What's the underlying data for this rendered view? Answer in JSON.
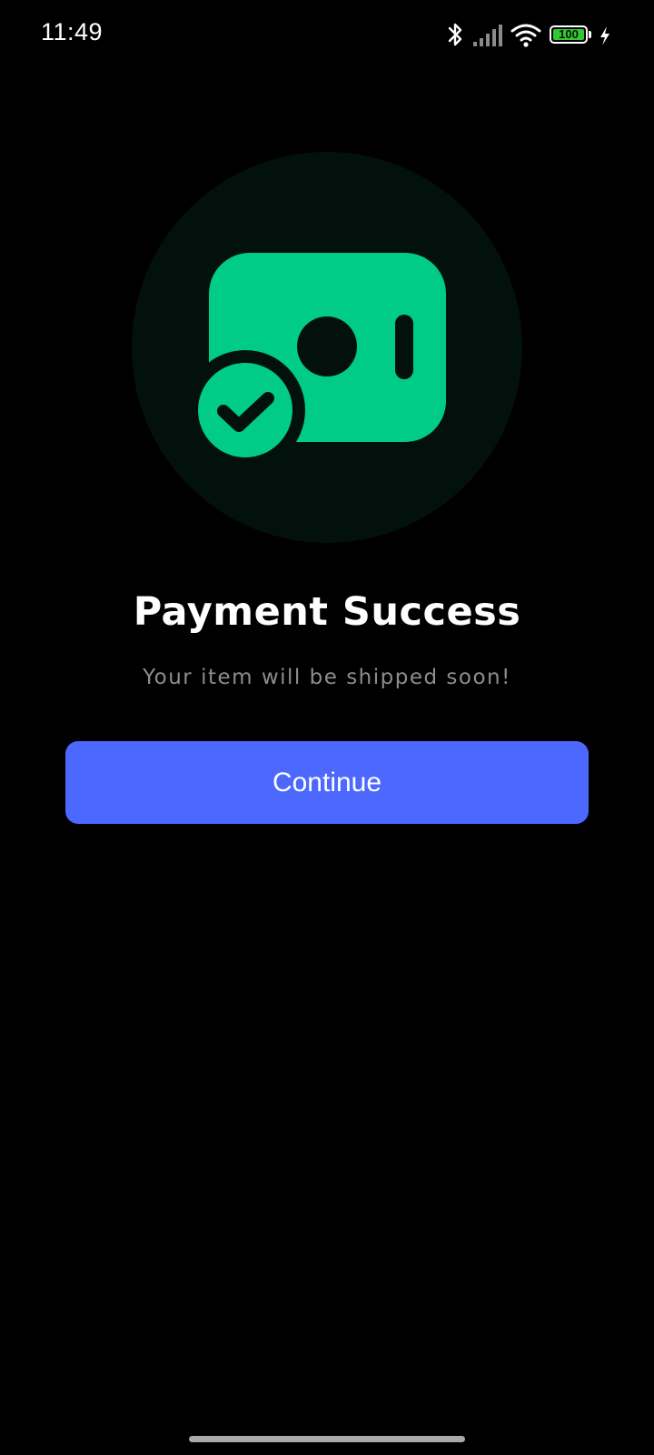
{
  "status_bar": {
    "time": "11:49",
    "battery_level": "100",
    "icons": [
      "bluetooth-icon",
      "signal-icon",
      "wifi-icon",
      "battery-icon",
      "charging-icon"
    ]
  },
  "hero": {
    "icon": "wallet-check-icon",
    "circle_color": "#03110c",
    "accent_color": "#00cc88"
  },
  "content": {
    "title": "Payment Success",
    "subtitle": "Your item will be shipped soon!"
  },
  "actions": {
    "continue_label": "Continue",
    "button_color": "#4c68ff"
  }
}
